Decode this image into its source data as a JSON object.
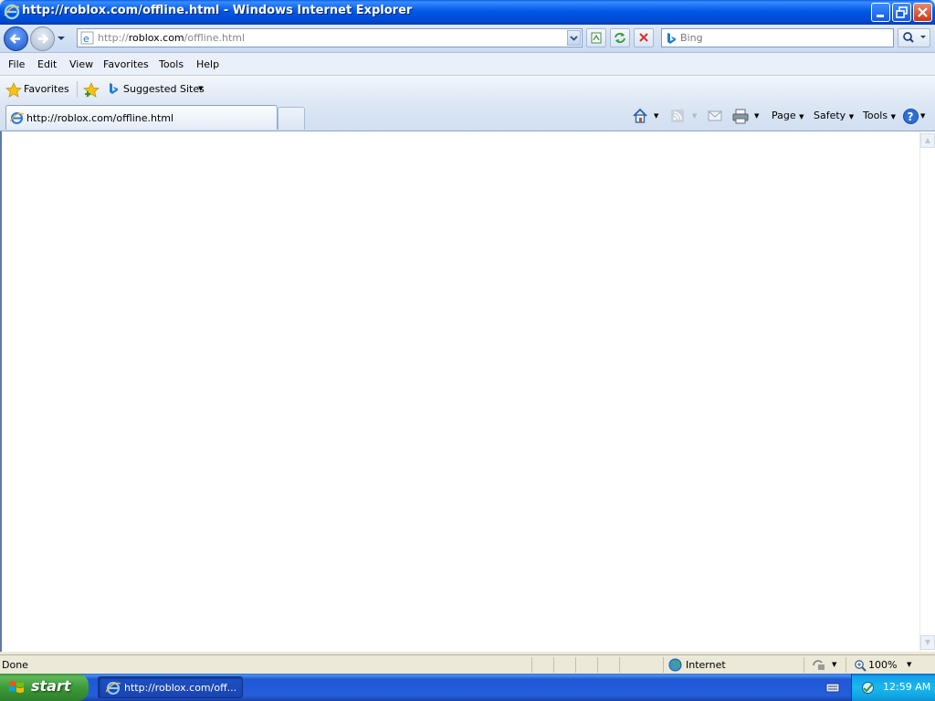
{
  "window": {
    "title": "http://roblox.com/offline.html - Windows Internet Explorer"
  },
  "navbar": {
    "address_prefix": "http://",
    "address_host": "roblox.com",
    "address_path": "/offline.html",
    "search_placeholder": "Bing"
  },
  "menu": {
    "items": [
      "File",
      "Edit",
      "View",
      "Favorites",
      "Tools",
      "Help"
    ]
  },
  "favorites_bar": {
    "favorites_label": "Favorites",
    "suggested_sites_label": "Suggested Sites"
  },
  "tabs": {
    "active_title": "http://roblox.com/offline.html"
  },
  "command_bar": {
    "page_label": "Page",
    "safety_label": "Safety",
    "tools_label": "Tools"
  },
  "statusbar": {
    "status_text": "Done",
    "zone_label": "Internet",
    "zoom_label": "100%"
  },
  "taskbar": {
    "start_label": "start",
    "task_item_label": "http://roblox.com/off...",
    "clock": "12:59 AM"
  },
  "colors": {
    "titlebar_blue": "#0058e8",
    "taskbar_blue": "#245edb",
    "start_green": "#3c9b38",
    "close_red": "#c8381c"
  }
}
